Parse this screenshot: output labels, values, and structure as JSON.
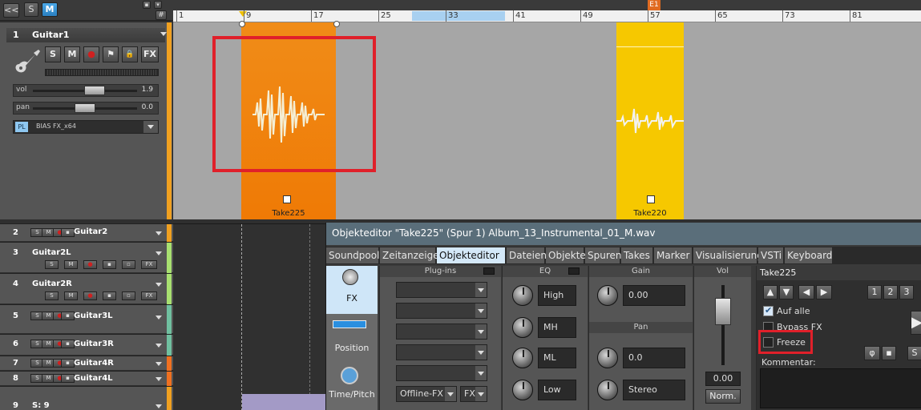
{
  "toolbar": {
    "back_label": "<<",
    "solo_label": "S",
    "mute_label": "M",
    "grid_label": "#"
  },
  "ruler": {
    "marks": [
      "1",
      "9",
      "17",
      "25",
      "33",
      "41",
      "49",
      "57",
      "65",
      "73",
      "81"
    ],
    "marker_label": "E1"
  },
  "track1": {
    "number": "1",
    "name": "Guitar2L",
    "buttons": [
      "S",
      "M",
      "●",
      "⚑",
      "🔒",
      "FX"
    ],
    "vol_label": "vol",
    "vol_value": "1.9",
    "pan_label": "pan",
    "pan_value": "0.0",
    "plugin_badge": "PL",
    "plugin_name": "BIAS FX_x64",
    "vol_level": 0.62,
    "pan_level": 0.5
  },
  "clips": [
    {
      "name": "Take225",
      "color": "#f07f0a"
    },
    {
      "name": "Take220",
      "color": "#f6c800"
    }
  ],
  "tracks": [
    {
      "number": "2",
      "name": "Guitar2",
      "color": "#f0a020"
    },
    {
      "number": "3",
      "name": "Guitar2L",
      "color": "#a8e070"
    },
    {
      "number": "4",
      "name": "Guitar2R",
      "color": "#a8e070"
    },
    {
      "number": "5",
      "name": "Guitar3L",
      "color": "#70c0a0"
    },
    {
      "number": "6",
      "name": "Guitar3R",
      "color": "#70c0a0"
    },
    {
      "number": "7",
      "name": "Guitar4R",
      "color": "#f07020"
    },
    {
      "number": "8",
      "name": "Guitar4L",
      "color": "#f07020"
    },
    {
      "number": "9",
      "name": "S: 9",
      "color": "#f0a020"
    }
  ],
  "track1_display_name": "Guitar1",
  "object_editor": {
    "title": "Objekteditor \"Take225\"  (Spur 1)   Album_13_Instrumental_01_M.wav",
    "tabs": [
      "Soundpool",
      "Zeitanzeige",
      "Objekteditor",
      "Dateien",
      "Objekte",
      "Spuren",
      "Takes",
      "Marker",
      "Visualisierung",
      "VSTi",
      "Keyboard"
    ],
    "active_tab": "Objekteditor",
    "tab_close": "×",
    "side": [
      "FX",
      "Position",
      "Time/Pitch"
    ],
    "plugins_header": "Plug-ins",
    "offline_fx": "Offline-FX",
    "fx_label": "FX",
    "eq_header": "EQ",
    "eq_bands": [
      "High",
      "MH",
      "ML",
      "Low"
    ],
    "gain_header": "Gain",
    "gain_value": "0.00",
    "pan_header": "Pan",
    "pan_value": "0.0",
    "pan_mode": "Stereo",
    "vol_header": "Vol",
    "vol_value": "0.00",
    "norm_label": "Norm.",
    "take_name": "Take225",
    "take_numbers": [
      "1",
      "2",
      "3"
    ],
    "auf_alle": "Auf alle",
    "bypass_fx": "Bypass FX",
    "freeze": "Freeze",
    "kommentar": "Kommentar:",
    "phase_label": "φ",
    "solo_label": "S"
  },
  "colors": {
    "highlight": "#e0202a",
    "accent": "#2a7fc0"
  }
}
